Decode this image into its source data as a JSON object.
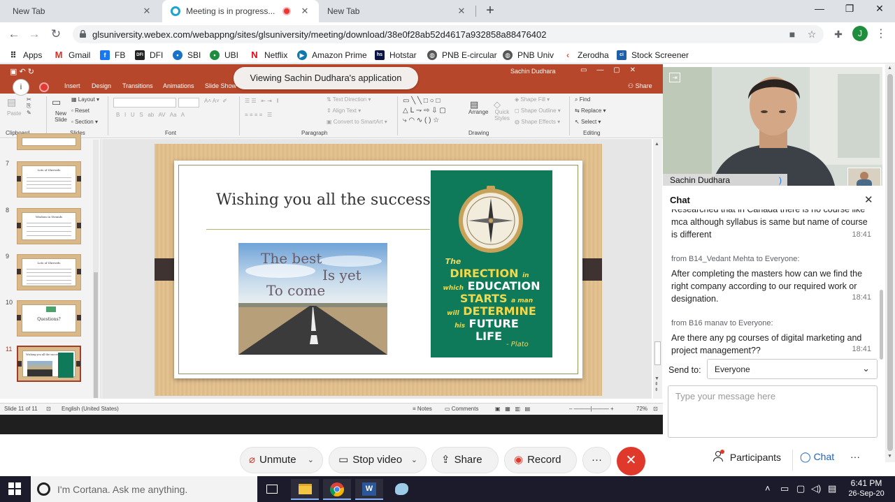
{
  "browser": {
    "tabs": [
      {
        "title": "New Tab",
        "active": false
      },
      {
        "title": "Meeting is in progress...",
        "active": true
      },
      {
        "title": "New Tab",
        "active": false
      }
    ],
    "url": "glsuniversity.webex.com/webappng/sites/glsuniversity/meeting/download/38e0f28ab52d4617a932858a88476402",
    "profile_initial": "J",
    "bookmarks": [
      {
        "label": "Apps",
        "icon": "apps-grid-icon"
      },
      {
        "label": "Gmail",
        "icon": "gmail-icon"
      },
      {
        "label": "FB",
        "icon": "facebook-icon"
      },
      {
        "label": "DFI",
        "icon": "dfi-icon"
      },
      {
        "label": "SBI",
        "icon": "sbi-icon"
      },
      {
        "label": "UBI",
        "icon": "ubi-icon"
      },
      {
        "label": "Netflix",
        "icon": "netflix-icon"
      },
      {
        "label": "Amazon Prime",
        "icon": "prime-video-icon"
      },
      {
        "label": "Hotstar",
        "icon": "hotstar-icon"
      },
      {
        "label": "PNB E-circular",
        "icon": "globe-icon"
      },
      {
        "label": "PNB Univ",
        "icon": "globe-icon"
      },
      {
        "label": "Zerodha",
        "icon": "zerodha-icon"
      },
      {
        "label": "Stock Screener",
        "icon": "screener-icon"
      }
    ]
  },
  "share": {
    "banner": "Viewing Sachin Dudhara's application",
    "ppt": {
      "user": "Sachin Dudhara",
      "share_label": "Share",
      "ribbon_tabs": [
        "Insert",
        "Design",
        "Transitions",
        "Animations",
        "Slide Show"
      ],
      "groups": [
        "Clipboard",
        "Slides",
        "Font",
        "Paragraph",
        "Drawing",
        "Editing"
      ],
      "slides_group": {
        "new_slide": "New Slide",
        "layout": "Layout",
        "reset": "Reset",
        "section": "Section",
        "paste": "Paste"
      },
      "paragraph_group": {
        "text_direction": "Text Direction",
        "align_text": "Align Text",
        "convert": "Convert to SmartArt"
      },
      "drawing_group": {
        "arrange": "Arrange",
        "quick_styles": "Quick Styles",
        "shape_fill": "Shape Fill",
        "shape_outline": "Shape Outline",
        "shape_effects": "Shape Effects"
      },
      "editing_group": {
        "find": "Find",
        "replace": "Replace",
        "select": "Select"
      },
      "thumbnails": [
        {
          "num": "7",
          "title": "Lots of Shrewds"
        },
        {
          "num": "8",
          "title": "Wisdom in Strands"
        },
        {
          "num": "9",
          "title": "Lots of Shrewds"
        },
        {
          "num": "10",
          "title": "Questions?"
        },
        {
          "num": "11",
          "title": "Wishing you all the success!"
        }
      ],
      "slide": {
        "title": "Wishing you all the success!",
        "road_text": [
          "The best",
          "Is yet",
          "To come"
        ],
        "quote": {
          "the": "The",
          "direction": "DIRECTION",
          "in": "in",
          "which": "which",
          "education": "EDUCATION",
          "starts": "STARTS",
          "a_man": "a man",
          "will": "will",
          "determine": "DETERMINE",
          "his": "his",
          "future": "FUTURE",
          "life": "LIFE",
          "author": "- Plato"
        }
      },
      "status": {
        "slide_of": "Slide 11 of 11",
        "language": "English (United States)",
        "notes": "Notes",
        "comments": "Comments",
        "zoom": "72%"
      }
    }
  },
  "video": {
    "name": "Sachin Dudhara"
  },
  "chat": {
    "title": "Chat",
    "messages": [
      {
        "from": "",
        "text": "Researched that in Canada there is no course like mca although syllabus is same but name of course is different",
        "time": "18:41"
      },
      {
        "from": "from B14_Vedant Mehta to Everyone:",
        "text": "After completing the masters how can we find the right company according to our required work or designation.",
        "time": "18:41"
      },
      {
        "from": "from B16 manav to Everyone:",
        "text": "Are there any pg courses of digital marketing and project management??",
        "time": "18:41"
      }
    ],
    "send_to_label": "Send to:",
    "send_to_value": "Everyone",
    "input_placeholder": "Type your message here"
  },
  "controls": {
    "unmute": "Unmute",
    "stop_video": "Stop video",
    "share": "Share",
    "record": "Record",
    "more": "···",
    "participants": "Participants",
    "chat": "Chat",
    "overflow": "···"
  },
  "taskbar": {
    "cortana": "I'm Cortana. Ask me anything.",
    "time": "6:41 PM",
    "date": "26-Sep-20"
  },
  "colors": {
    "ppt_accent": "#b7472a",
    "end_meeting": "#e0382b",
    "chat_accent": "#1565c0"
  }
}
